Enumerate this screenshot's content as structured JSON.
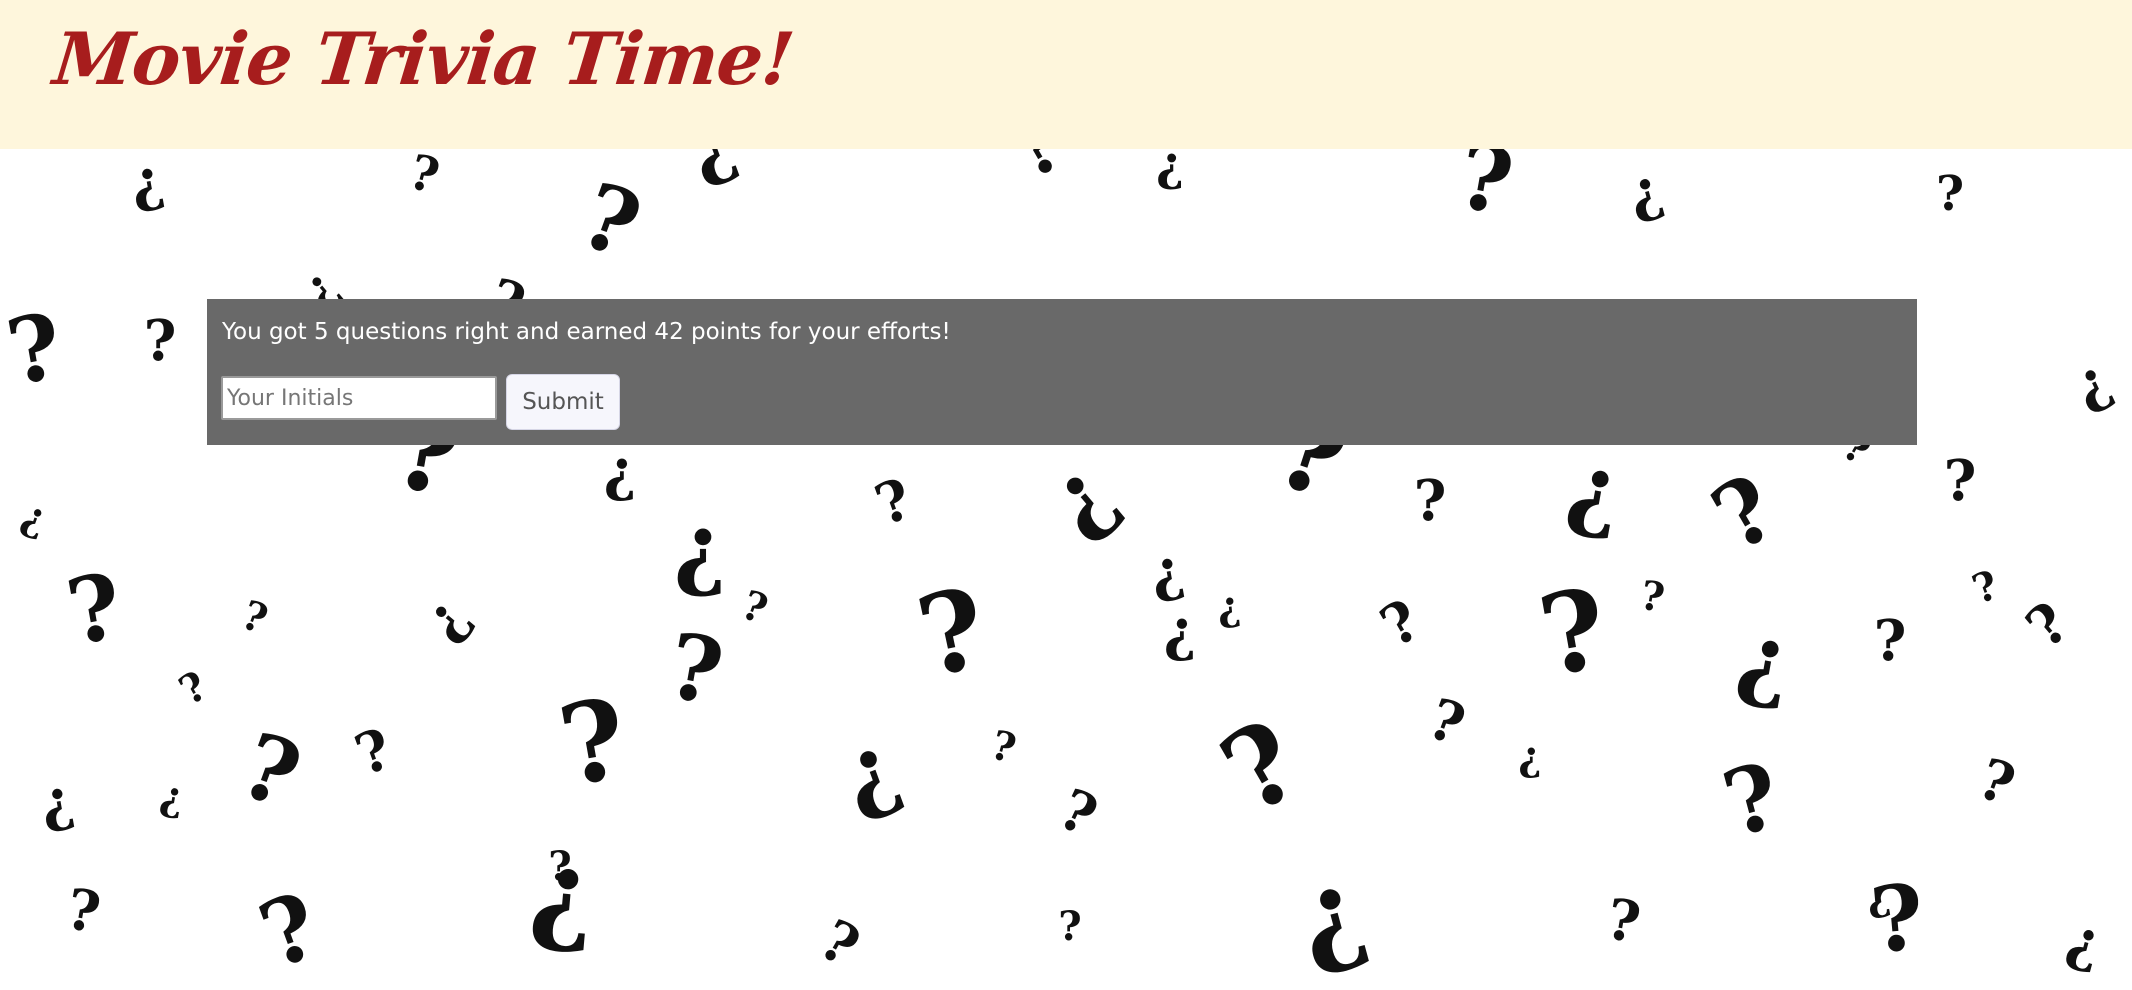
{
  "app": {
    "title": "Movie Trivia Time!"
  },
  "result": {
    "message": "You got 5 questions right and earned 42 points for your efforts!"
  },
  "form": {
    "initials_placeholder": "Your Initials",
    "initials_value": "",
    "submit_label": "Submit"
  },
  "colors": {
    "header_bg": "#fef6dc",
    "title": "#a71d1d",
    "panel_bg": "#696969",
    "pattern": "#111111"
  },
  "background": {
    "pattern": "question-mark-pattern-icon"
  }
}
